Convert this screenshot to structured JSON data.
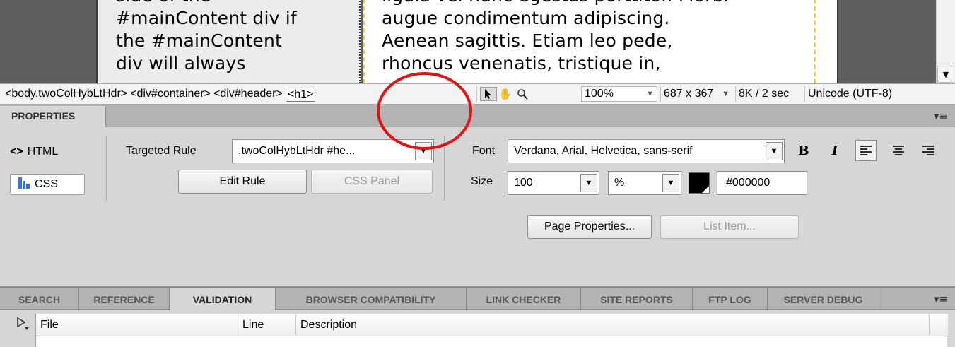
{
  "design_view": {
    "left_column_lines": [
      "side of the",
      "#mainContent div if",
      "the #mainContent",
      "div will always"
    ],
    "main_column_lines": [
      "ligula vel nunc egestas porttitor. Morbi",
      "augue condimentum adipiscing.",
      "Aenean sagittis. Etiam leo pede,",
      "rhoncus venenatis, tristique in,"
    ]
  },
  "status_bar": {
    "tags": [
      "<body.twoColHybLtHdr>",
      "<div#container>",
      "<div#header>",
      "<h1>"
    ],
    "tools": [
      "select-tool",
      "hand-tool",
      "zoom-tool"
    ],
    "zoom": "100%",
    "window_size": "687 x 367",
    "download_time": "8K / 2 sec",
    "encoding": "Unicode (UTF-8)"
  },
  "properties": {
    "tab_label": "PROPERTIES",
    "html_label": "HTML",
    "css_label": "CSS",
    "targeted_rule_label": "Targeted Rule",
    "targeted_rule_value": ".twoColHybLtHdr #he...",
    "edit_rule_label": "Edit Rule",
    "css_panel_label": "CSS Panel",
    "font_label": "Font",
    "font_value": "Verdana, Arial, Helvetica, sans-serif",
    "bold_label": "B",
    "italic_label": "I",
    "size_label": "Size",
    "size_value": "100",
    "size_unit": "%",
    "color_value": "#000000",
    "page_properties_label": "Page Properties...",
    "list_item_label": "List Item..."
  },
  "results": {
    "tabs": [
      "SEARCH",
      "REFERENCE",
      "VALIDATION",
      "BROWSER COMPATIBILITY",
      "LINK CHECKER",
      "SITE REPORTS",
      "FTP LOG",
      "SERVER DEBUG"
    ],
    "active_tab": "VALIDATION",
    "columns": [
      "File",
      "Line",
      "Description"
    ]
  },
  "colors": {
    "annotation": "#e01414",
    "text_color_swatch": "#000000"
  }
}
